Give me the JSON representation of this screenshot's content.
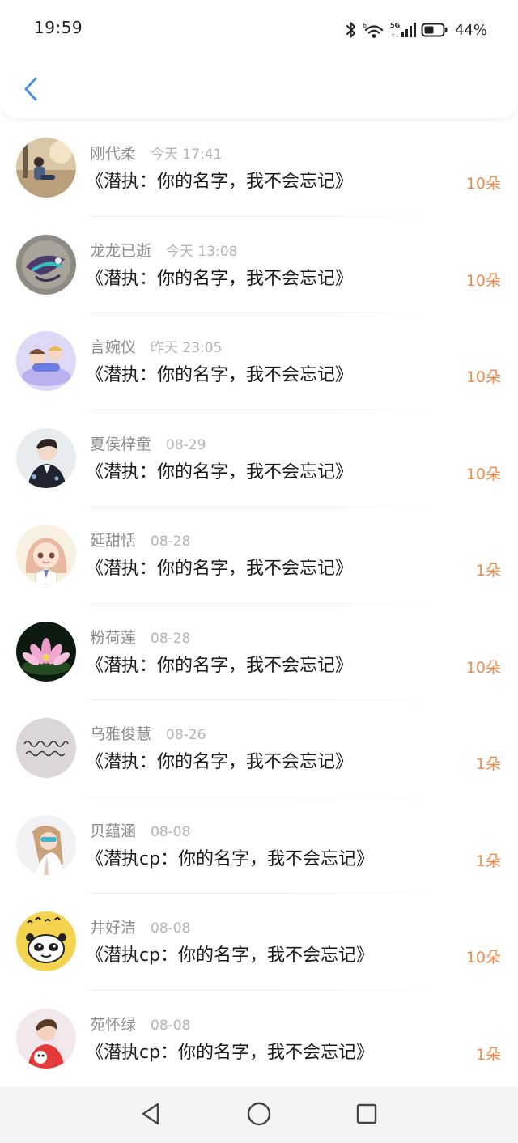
{
  "status_bar": {
    "time": "19:59",
    "battery_percent": "44%",
    "icons": [
      "bluetooth-icon",
      "wifi-icon",
      "cellular-5g-icon",
      "battery-icon"
    ]
  },
  "header": {
    "back_icon": "chevron-left-icon",
    "accent_color": "#4a90e2"
  },
  "list": {
    "count_color": "#ee8a4a",
    "items": [
      {
        "name": "刚代柔",
        "time": "今天 17:41",
        "title": "《潜执：你的名字，我不会忘记》",
        "count": "10朵"
      },
      {
        "name": "龙龙已逝",
        "time": "今天 13:08",
        "title": "《潜执：你的名字，我不会忘记》",
        "count": "10朵"
      },
      {
        "name": "言婉仪",
        "time": "昨天 23:05",
        "title": "《潜执：你的名字，我不会忘记》",
        "count": "10朵"
      },
      {
        "name": "夏侯梓童",
        "time": "08-29",
        "title": "《潜执：你的名字，我不会忘记》",
        "count": "10朵"
      },
      {
        "name": "延甜恬",
        "time": "08-28",
        "title": "《潜执：你的名字，我不会忘记》",
        "count": "1朵"
      },
      {
        "name": "粉荷莲",
        "time": "08-28",
        "title": "《潜执：你的名字，我不会忘记》",
        "count": "10朵"
      },
      {
        "name": "乌雅俊慧",
        "time": "08-26",
        "title": "《潜执：你的名字，我不会忘记》",
        "count": "1朵"
      },
      {
        "name": "贝蕴涵",
        "time": "08-08",
        "title": "《潜执cp：你的名字，我不会忘记》",
        "count": "1朵"
      },
      {
        "name": "井好洁",
        "time": "08-08",
        "title": "《潜执cp：你的名字，我不会忘记》",
        "count": "10朵"
      },
      {
        "name": "苑怀绿",
        "time": "08-08",
        "title": "《潜执cp：你的名字，我不会忘记》",
        "count": "1朵"
      }
    ]
  },
  "nav_bar": {
    "icons": [
      "back-triangle-icon",
      "home-circle-icon",
      "recents-square-icon"
    ]
  }
}
